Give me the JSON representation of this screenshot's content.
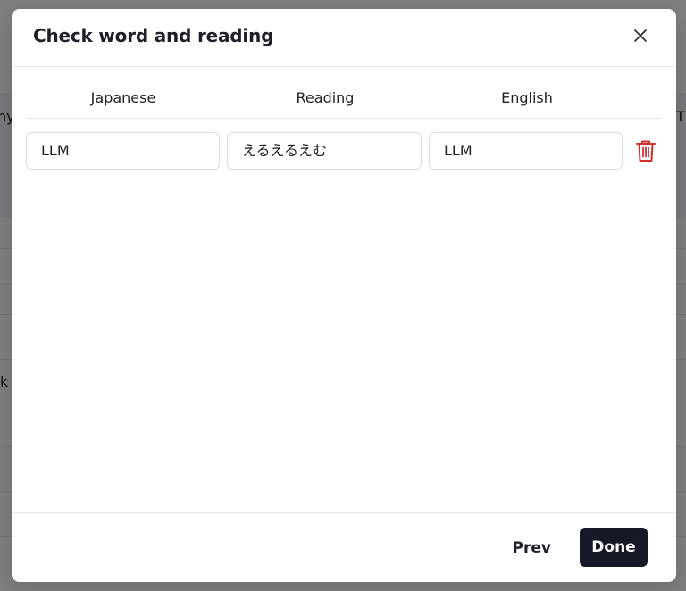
{
  "background": {
    "partial_texts": [
      "ny",
      "Th",
      "k"
    ]
  },
  "modal": {
    "title": "Check word and reading",
    "columns": [
      "Japanese",
      "Reading",
      "English"
    ],
    "rows": [
      {
        "japanese": "LLM",
        "reading": "えるえるえむ",
        "english": "LLM"
      }
    ],
    "footer": {
      "prev_label": "Prev",
      "done_label": "Done"
    }
  },
  "colors": {
    "primary": "#151826",
    "delete": "#d32f2f",
    "border": "#dddddd"
  },
  "icons": {
    "close": "close-icon",
    "delete": "trash-icon"
  }
}
